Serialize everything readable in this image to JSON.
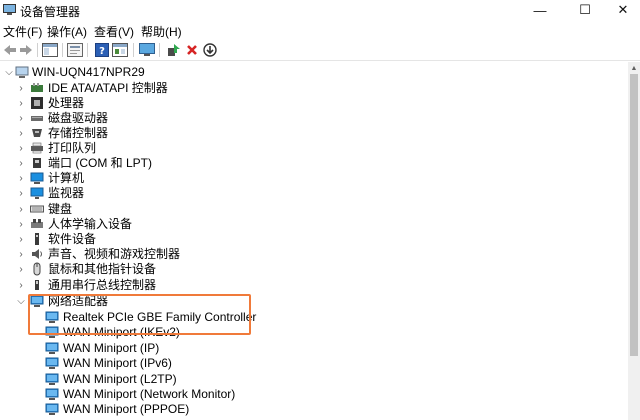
{
  "window": {
    "title": "设备管理器",
    "controls": {
      "minimize": "—",
      "maximize": "☐",
      "close": "✕"
    }
  },
  "menu": [
    "文件(F)",
    "操作(A)",
    "查看(V)",
    "帮助(H)"
  ],
  "toolbar": {
    "buttons": [
      "back-icon",
      "forward-icon",
      "show-hide-tree-icon",
      "properties-icon",
      "help-icon",
      "view-icon",
      "monitor-icon",
      "update-driver-icon",
      "uninstall-icon",
      "download-icon"
    ]
  },
  "tree": {
    "root": "WIN-UQN417NPR29",
    "categories": [
      {
        "label": "IDE ATA/ATAPI 控制器",
        "icon": "ide-controller-icon"
      },
      {
        "label": "处理器",
        "icon": "processor-icon"
      },
      {
        "label": "磁盘驱动器",
        "icon": "disk-drive-icon"
      },
      {
        "label": "存储控制器",
        "icon": "storage-controller-icon"
      },
      {
        "label": "打印队列",
        "icon": "printer-icon"
      },
      {
        "label": "端口 (COM 和 LPT)",
        "icon": "port-icon"
      },
      {
        "label": "计算机",
        "icon": "computer-icon"
      },
      {
        "label": "监视器",
        "icon": "monitor-icon"
      },
      {
        "label": "键盘",
        "icon": "keyboard-icon"
      },
      {
        "label": "人体学输入设备",
        "icon": "hid-icon"
      },
      {
        "label": "软件设备",
        "icon": "software-device-icon"
      },
      {
        "label": "声音、视频和游戏控制器",
        "icon": "sound-icon"
      },
      {
        "label": "鼠标和其他指针设备",
        "icon": "mouse-icon"
      },
      {
        "label": "通用串行总线控制器",
        "icon": "usb-icon"
      },
      {
        "label": "网络适配器",
        "icon": "network-adapter-icon"
      }
    ],
    "network_adapters": [
      "Realtek PCIe GBE Family Controller",
      "WAN Miniport (IKEv2)",
      "WAN Miniport (IP)",
      "WAN Miniport (IPv6)",
      "WAN Miniport (L2TP)",
      "WAN Miniport (Network Monitor)",
      "WAN Miniport (PPPOE)"
    ]
  },
  "colors": {
    "highlight": "#f07a3a",
    "network_icon": "#2b88d8"
  }
}
